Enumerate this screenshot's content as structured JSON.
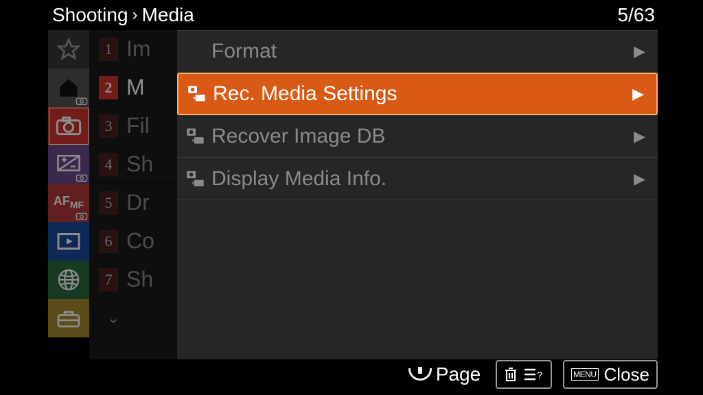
{
  "breadcrumb": {
    "section": "Shooting",
    "page": "Media"
  },
  "page_counter": {
    "current": 5,
    "total": 63,
    "display": "5/63"
  },
  "tab_icons": [
    {
      "name": "favorites",
      "icon": "star"
    },
    {
      "name": "main",
      "icon": "home"
    },
    {
      "name": "shooting",
      "icon": "camera",
      "active": true
    },
    {
      "name": "exposure",
      "icon": "exposure"
    },
    {
      "name": "focus",
      "icon": "afmf"
    },
    {
      "name": "playback",
      "icon": "play"
    },
    {
      "name": "network",
      "icon": "globe"
    },
    {
      "name": "setup",
      "icon": "toolbox"
    }
  ],
  "section_pages": [
    {
      "index": 1,
      "label_cut": "Im"
    },
    {
      "index": 2,
      "label_cut": "M",
      "active": true
    },
    {
      "index": 3,
      "label_cut": "Fil"
    },
    {
      "index": 4,
      "label_cut": "Sh"
    },
    {
      "index": 5,
      "label_cut": "Dr"
    },
    {
      "index": 6,
      "label_cut": "Co"
    },
    {
      "index": 7,
      "label_cut": "Sh"
    }
  ],
  "menu": {
    "items": [
      {
        "label": "Format",
        "has_icon": false,
        "selected": false
      },
      {
        "label": "Rec. Media Settings",
        "has_icon": true,
        "selected": true
      },
      {
        "label": "Recover Image DB",
        "has_icon": true,
        "selected": false
      },
      {
        "label": "Display Media Info.",
        "has_icon": true,
        "selected": false
      }
    ]
  },
  "footer": {
    "page_label": "Page",
    "help_label": "",
    "close_label": "Close",
    "menu_badge": "MENU"
  }
}
